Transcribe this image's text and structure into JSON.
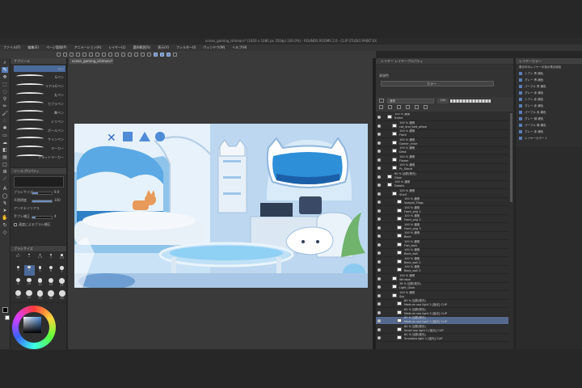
{
  "window": {
    "title": "ocean_gaming_ishimaru* (1920 x 1080 px 350dpi 100.0%) - ROUNDS ROOMS 2.0 - CLIP STUDIO PAINT EX"
  },
  "menu": [
    "ファイル(F)",
    "編集(E)",
    "ページ管理(P)",
    "アニメーション(A)",
    "レイヤー(L)",
    "選択範囲(S)",
    "表示(V)",
    "フィルター(I)",
    "ウィンドウ(W)",
    "ヘルプ(H)"
  ],
  "document_tab": "ocean_gaming_ishimaru*",
  "subtool": {
    "header": "サブツール",
    "active": "ペン",
    "brushes": [
      "Gペン",
      "リアルGペン",
      "丸ペン",
      "カブラペン",
      "筆ペン",
      "ミリペン",
      "ボールペン",
      "サインペン",
      "マーカー",
      "フラットマーカー"
    ]
  },
  "tool_property": {
    "header": "ツールプロパティ",
    "rows": [
      {
        "label": "ブラシサイズ",
        "value": "9.0"
      },
      {
        "label": "不透明度",
        "value": "100"
      },
      {
        "label": "アンチエイリアス",
        "value": ""
      },
      {
        "label": "手ブレ補正",
        "value": "4"
      },
      {
        "label": "速度によるブラシ補正",
        "value": ""
      }
    ]
  },
  "brush_size": {
    "header": "ブラシサイズ",
    "sizes": [
      "0.7",
      "1",
      "1.5",
      "2",
      "2.5",
      "3",
      "4",
      "5",
      "6",
      "7",
      "8",
      "10",
      "12",
      "15",
      "17",
      "20",
      "25",
      "30",
      "40",
      "50"
    ]
  },
  "layer_panel": {
    "tabs": "レイヤー  レイヤープロパティ",
    "expression_color": "表現色",
    "color_mode": "カラー",
    "blend": "通常",
    "opacity": "100",
    "layers": [
      {
        "name": "100 % 通常",
        "sub": "frame",
        "indent": 0
      },
      {
        "name": "100 % 通常",
        "sub": "cat_and_bed_pillow",
        "indent": 1
      },
      {
        "name": "100 % 通常",
        "sub": "Front",
        "indent": 1
      },
      {
        "name": "100 % 通常",
        "sub": "Gamer_chair",
        "indent": 1
      },
      {
        "name": "100 % 通常",
        "sub": "Desk",
        "indent": 1
      },
      {
        "name": "100 % 通常",
        "sub": "Flower",
        "indent": 1
      },
      {
        "name": "100 % 通常",
        "sub": "Pc_Stand",
        "indent": 1
      },
      {
        "name": "60 % 加算(発光)",
        "sub": "Glow",
        "indent": 0
      },
      {
        "name": "100 % 通常",
        "sub": "Details",
        "indent": 0
      },
      {
        "name": "100 % 通常",
        "sub": "Shelf",
        "indent": 1
      },
      {
        "name": "100 % 通常",
        "sub": "Seagull_Flags",
        "indent": 2
      },
      {
        "name": "100 % 通常",
        "sub": "Front_png 1",
        "indent": 2
      },
      {
        "name": "100 % 通常",
        "sub": "Front_png 2",
        "indent": 2
      },
      {
        "name": "100 % 通常",
        "sub": "Front_png 3",
        "indent": 2
      },
      {
        "name": "100 % 通常",
        "sub": "Back",
        "indent": 2
      },
      {
        "name": "100 % 通常",
        "sub": "Fish_tank",
        "indent": 2
      },
      {
        "name": "100 % 通常",
        "sub": "Back_wall",
        "indent": 2
      },
      {
        "name": "100 % 通常",
        "sub": "Back_wall 2",
        "indent": 2
      },
      {
        "name": "100 % 通常",
        "sub": "Back_wall 3",
        "indent": 2
      },
      {
        "name": "100 % 通常",
        "sub": "Window",
        "indent": 1
      },
      {
        "name": "38 % 加算(発光)",
        "sub": "Light_Glow",
        "indent": 1
      },
      {
        "name": "100 % 通常",
        "sub": "Sky",
        "indent": 1
      },
      {
        "name": "80 % 加算(発光)",
        "sub": "Medium sea light 2 [強光] CLIP",
        "indent": 2
      },
      {
        "name": "80 % 加算(発光)",
        "sub": "Medium sea light 3 [強光] CLIP",
        "indent": 2
      },
      {
        "name": "80 % 加算(発光)",
        "sub": "Medium sea light 1 [強光] CLIP",
        "indent": 2
      },
      {
        "name": "80 % 加算(発光)",
        "sub": "Small sea light 2 [強光] CLIP",
        "indent": 2
      },
      {
        "name": "80 % 加算(発光)",
        "sub": "Smallsea light 1 [強光] CLIP",
        "indent": 2
      }
    ],
    "selected_index": 24
  },
  "side_panel": {
    "header": "レイヤーカラー",
    "title": "表示中のレイヤーの色の表示設定",
    "items": [
      "シアン 青 補色",
      "グレー 青 補色",
      "パープル 青 補色",
      "グレー 赤 補色",
      "シアン 赤 補色",
      "グレー 赤 補色",
      "パープル 赤 補色",
      "グレー 緑 補色",
      "パープル 緑 補色",
      "グレー 赤 補色",
      "レイヤーカラー 1"
    ]
  },
  "colors": {
    "accent": "#5a7fb8",
    "panel": "#2e2e2e",
    "background": "#272727"
  }
}
